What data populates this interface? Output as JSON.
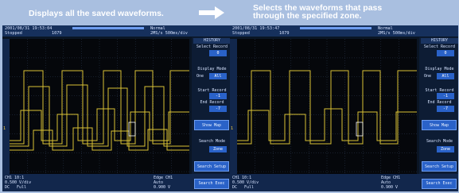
{
  "header": {
    "left_label": "Displays all the saved waveforms.",
    "right_label_line1": "Selects the waveforms that pass",
    "right_label_line2": "through the specified zone."
  },
  "screens": [
    {
      "datetime": "2001/08/31 19:53:04",
      "status": "Stopped",
      "count": "1079",
      "trig_mode": "Normal",
      "rate": "2MS/s 500ms/div",
      "menu_title": "HISTORY",
      "select_record_label": "Select Record",
      "select_record_value": "0",
      "display_mode_label": "Display Mode",
      "display_mode_value_a": "One",
      "display_mode_value_b": "All",
      "start_record_label": "Start Record",
      "start_record_value": "-1",
      "end_record_label": "End Record",
      "end_record_value": "-7",
      "show_map": "Show Map",
      "search_mode_label": "Search Mode",
      "search_mode_value": "Zone",
      "search_setup": "Search Setup",
      "search_exec": "Search Exec",
      "ch_info": "CH1 10:1",
      "vdiv": "0.500 V/div",
      "coupling": "DC",
      "bw": "Full",
      "trigger": "Edge CH1",
      "trig_mode_bottom": "Auto",
      "trig_level": "0.900 V"
    },
    {
      "datetime": "2001/08/31 19:53:47",
      "status": "Stopped",
      "count": "1079",
      "trig_mode": "Normal",
      "rate": "2MS/s 500ms/div",
      "menu_title": "HISTORY",
      "select_record_label": "Select Record",
      "select_record_value": "0",
      "display_mode_label": "Display Mode",
      "display_mode_value_a": "One",
      "display_mode_value_b": "All",
      "start_record_label": "Start Record",
      "start_record_value": "-1",
      "end_record_label": "End Record",
      "end_record_value": "-7",
      "show_map": "Show Map",
      "search_mode_label": "Search Mode",
      "search_mode_value": "Zone",
      "search_setup": "Search Setup",
      "search_exec": "Search Exec",
      "ch_info": "CH1 10:1",
      "vdiv": "0.500 V/div",
      "coupling": "DC",
      "bw": "Full",
      "trigger": "Edge CH1",
      "trig_mode_bottom": "Auto",
      "trig_level": "0.900 V"
    }
  ],
  "colors": {
    "background": "#a9bfe0",
    "screen_bg": "#0a1524",
    "waveform": "#d9c234",
    "menu_button": "#2a62c8"
  },
  "icons": {
    "header_arrow": "arrow-right-icon",
    "edge_trigger": "rising-edge-icon"
  }
}
